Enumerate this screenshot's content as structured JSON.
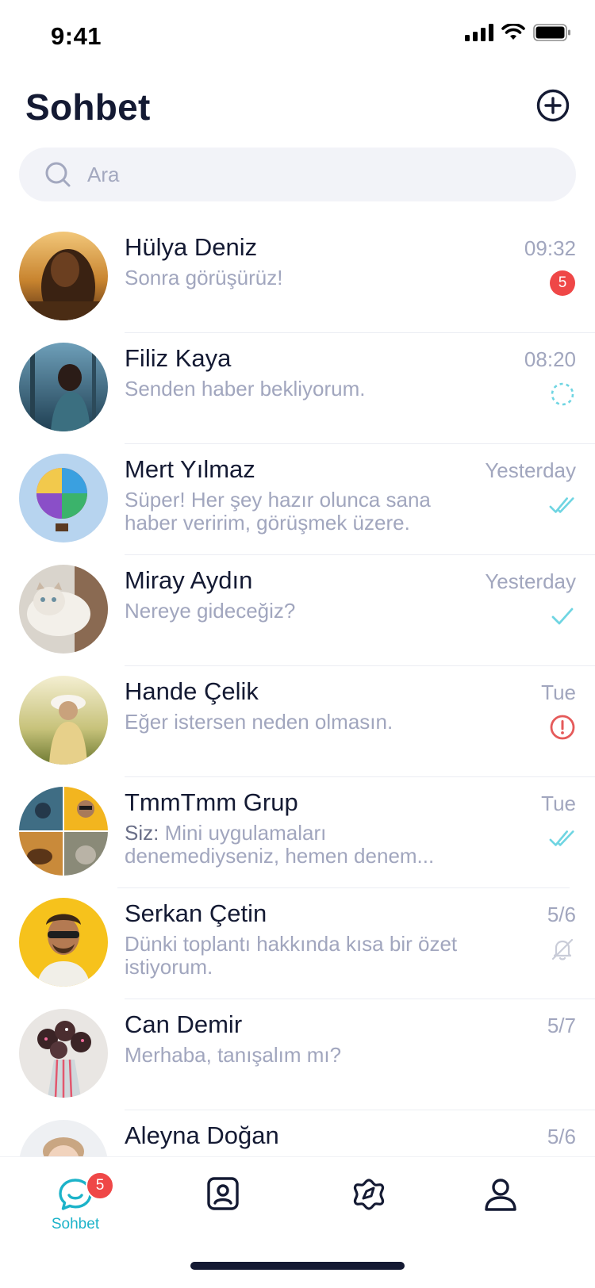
{
  "status_bar": {
    "time": "9:41"
  },
  "header": {
    "title": "Sohbet"
  },
  "search": {
    "placeholder": "Ara"
  },
  "colors": {
    "accent": "#1cb3c9",
    "badge": "#ef4747",
    "error": "#e55a5a",
    "text_primary": "#141a33",
    "text_secondary": "#a1a6be",
    "search_bg": "#f2f3f8"
  },
  "chats": [
    {
      "name": "Hülya Deniz",
      "message": "Sonra görüşürüz!",
      "time": "09:32",
      "status": "unread",
      "unread_count": "5",
      "avatar": "woman-sunset-photo"
    },
    {
      "name": "Filiz Kaya",
      "message": "Senden haber bekliyorum.",
      "time": "08:20",
      "status": "pending-icon",
      "avatar": "woman-forest-photo"
    },
    {
      "name": "Mert Yılmaz",
      "message": "Süper! Her şey hazır olunca sana haber veririm, görüşmek üzere.",
      "time": "Yesterday",
      "status": "double-check-icon",
      "avatar": "hot-air-balloon-photo"
    },
    {
      "name": "Miray Aydın",
      "message": "Nereye gideceğiz?",
      "time": "Yesterday",
      "status": "check-icon",
      "avatar": "cat-photo"
    },
    {
      "name": "Hande Çelik",
      "message": "Eğer istersen neden olmasın.",
      "time": "Tue",
      "status": "error-icon",
      "avatar": "woman-field-photo"
    },
    {
      "name": "TmmTmm Grup",
      "sender": "Siz:",
      "message": "Mini uygulamaları denemediyseniz, hemen denem...",
      "time": "Tue",
      "status": "double-check-icon",
      "avatar": "group-collage-photo"
    },
    {
      "name": "Serkan Çetin",
      "message": "Dünki toplantı hakkında kısa bir özet istiyorum.",
      "time": "5/6",
      "status": "muted-bell-icon",
      "avatar": "man-sunglasses-photo"
    },
    {
      "name": "Can Demir",
      "message": "Merhaba, tanışalım mı?",
      "time": "5/7",
      "status": "none",
      "avatar": "cake-pops-photo"
    },
    {
      "name": "Aleyna Doğan",
      "message": "",
      "time": "5/6",
      "status": "none",
      "avatar": "child-photo"
    }
  ],
  "tab_bar": {
    "tabs": [
      {
        "label": "Sohbet",
        "icon": "chat-bubble-icon",
        "active": true,
        "badge": "5"
      },
      {
        "label": "",
        "icon": "contacts-icon",
        "active": false
      },
      {
        "label": "",
        "icon": "discover-icon",
        "active": false
      },
      {
        "label": "",
        "icon": "profile-icon",
        "active": false
      }
    ]
  }
}
